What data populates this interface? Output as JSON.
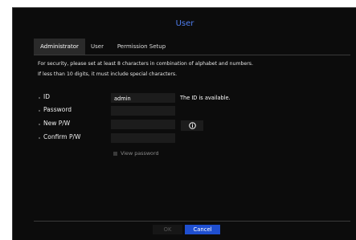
{
  "dialog": {
    "title": "User"
  },
  "tabs": [
    {
      "label": "Administrator",
      "active": true
    },
    {
      "label": "User",
      "active": false
    },
    {
      "label": "Permission Setup",
      "active": false
    }
  ],
  "notice": {
    "line1": "For security, please set at least 8 characters in combination of alphabet and numbers.",
    "line2": "If less than 10 digits, it must include special characters."
  },
  "form": {
    "id_label": "ID",
    "id_value": "admin",
    "id_status": "The ID is available.",
    "password_label": "Password",
    "new_pw_label": "New P/W",
    "confirm_pw_label": "Confirm P/W",
    "view_password_label": "View password",
    "info_icon": "info-icon"
  },
  "buttons": {
    "ok_label": "OK",
    "cancel_label": "Cancel"
  },
  "colors": {
    "title_accent": "#4f7ef0",
    "cancel_button": "#1f4fd0",
    "background": "#0c0c0c"
  }
}
